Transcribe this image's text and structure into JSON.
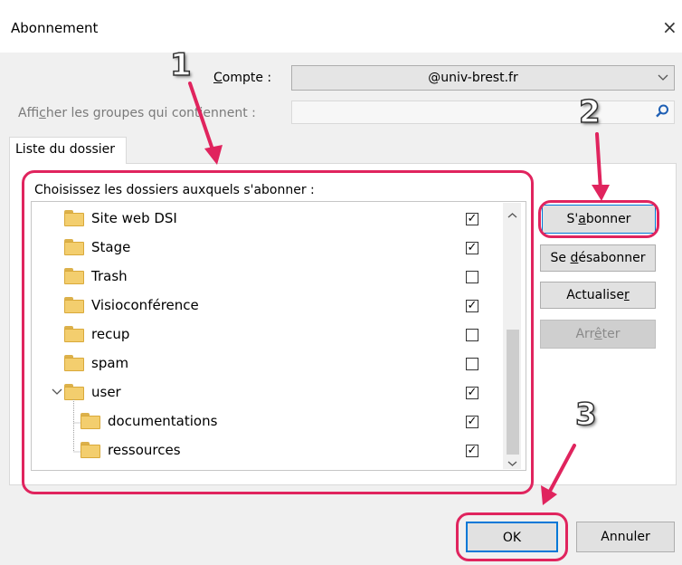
{
  "dialog": {
    "title": "Abonnement",
    "close_glyph": "×"
  },
  "account": {
    "label_pre": "",
    "label_u": "C",
    "label_post": "ompte :",
    "value": "@univ-brest.fr"
  },
  "filter": {
    "label_pre": "Affi",
    "label_u": "c",
    "label_post": "her les groupes qui contiennent :",
    "value": ""
  },
  "tab": {
    "label": "Liste du dossier"
  },
  "tree": {
    "caption": "Choisissez les dossiers auxquels s'abonner :",
    "items": [
      {
        "name": "Site web DSI",
        "level": 0,
        "checked": "✓"
      },
      {
        "name": "Stage",
        "level": 0,
        "checked": "✓"
      },
      {
        "name": "Trash",
        "level": 0,
        "checked": ""
      },
      {
        "name": "Visioconférence",
        "level": 0,
        "checked": "✓"
      },
      {
        "name": "recup",
        "level": 0,
        "checked": ""
      },
      {
        "name": "spam",
        "level": 0,
        "checked": ""
      },
      {
        "name": "user",
        "level": 0,
        "checked": "✓",
        "expanded": true
      },
      {
        "name": "documentations",
        "level": 1,
        "checked": "✓"
      },
      {
        "name": "ressources",
        "level": 1,
        "checked": "✓"
      }
    ]
  },
  "buttons": {
    "subscribe": {
      "pre": "S'",
      "u": "a",
      "post": "bonner"
    },
    "unsubscribe": {
      "pre": "Se ",
      "u": "d",
      "post": "ésabonner"
    },
    "refresh": {
      "pre": "Actualise",
      "u": "r",
      "post": ""
    },
    "stop": {
      "pre": "Arr",
      "u": "ê",
      "post": "ter"
    },
    "ok": "OK",
    "cancel": "Annuler"
  },
  "annotations": [
    "1",
    "2",
    "3"
  ],
  "colors": {
    "annotation": "#e0245e",
    "folder": "#f3ce6e"
  }
}
